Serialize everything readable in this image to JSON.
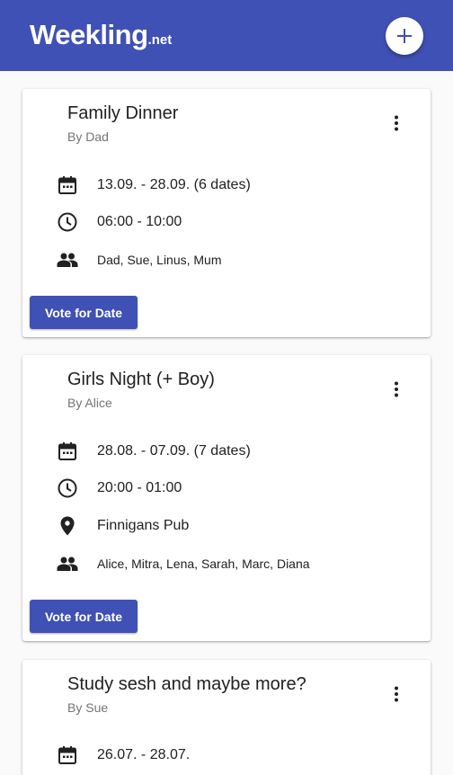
{
  "app": {
    "logo_main": "Weekling",
    "logo_suffix": ".net",
    "add_icon": "plus-icon",
    "accent_color": "#3f51b5"
  },
  "events": [
    {
      "title": "Family Dinner",
      "author": "By Dad",
      "dates": "13.09. - 28.09. (6 dates)",
      "time": "06:00 - 10:00",
      "participants": "Dad, Sue, Linus, Mum",
      "vote_label": "Vote for Date"
    },
    {
      "title": "Girls Night (+ Boy)",
      "author": "By Alice",
      "dates": "28.08. - 07.09. (7 dates)",
      "time": "20:00 - 01:00",
      "location": "Finnigans Pub",
      "participants": "Alice, Mitra, Lena, Sarah, Marc, Diana",
      "vote_label": "Vote for Date"
    },
    {
      "title": "Study sesh and maybe more?",
      "author": "By Sue",
      "dates": "26.07. - 28.07."
    }
  ]
}
